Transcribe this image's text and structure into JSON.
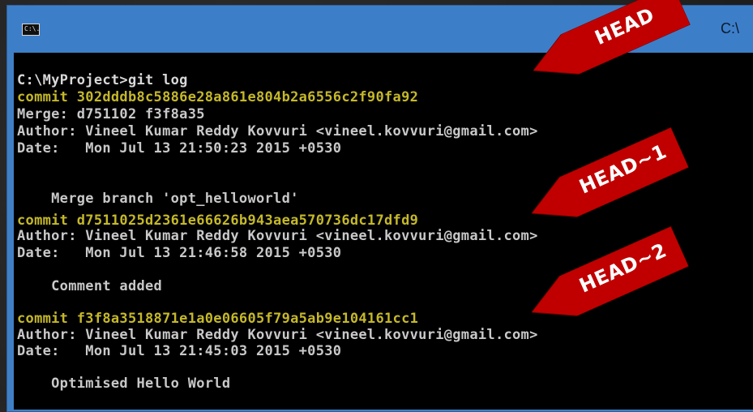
{
  "window": {
    "title": "C:\\",
    "icon": "cmd-icon",
    "icon_text": "C:\\."
  },
  "console": {
    "lines": [
      {
        "text": "C:\\MyProject>git log",
        "kind": "prompt"
      },
      {
        "text": "commit 302dddb8c5886e28a861e804b2a6556c2f90fa92",
        "kind": "commit"
      },
      {
        "text": "Merge: d751102 f3f8a35",
        "kind": "text"
      },
      {
        "text": "Author: Vineel Kumar Reddy Kovvuri <vineel.kovvuri@gmail.com>",
        "kind": "text"
      },
      {
        "text": "Date:   Mon Jul 13 21:50:23 2015 +0530",
        "kind": "text"
      },
      {
        "text": "",
        "kind": "text"
      },
      {
        "text": "    Merge branch 'opt_helloworld'",
        "kind": "text"
      },
      {
        "text": "",
        "kind": "text"
      },
      {
        "text": "commit d7511025d2361e66626b943aea570736dc17dfd9",
        "kind": "commit"
      },
      {
        "text": "Author: Vineel Kumar Reddy Kovvuri <vineel.kovvuri@gmail.com>",
        "kind": "text"
      },
      {
        "text": "Date:   Mon Jul 13 21:46:58 2015 +0530",
        "kind": "text"
      },
      {
        "text": "",
        "kind": "text"
      },
      {
        "text": "    Comment added",
        "kind": "text"
      },
      {
        "text": "",
        "kind": "text"
      },
      {
        "text": "commit f3f8a3518871e1a0e06605f79a5ab9e104161cc1",
        "kind": "commit"
      },
      {
        "text": "Author: Vineel Kumar Reddy Kovvuri <vineel.kovvuri@gmail.com>",
        "kind": "text"
      },
      {
        "text": "Date:   Mon Jul 13 21:45:03 2015 +0530",
        "kind": "text"
      },
      {
        "text": "",
        "kind": "text"
      },
      {
        "text": "    Optimised Hello World",
        "kind": "text"
      }
    ]
  },
  "annotations": [
    {
      "label": "HEAD"
    },
    {
      "label": "HEAD~1"
    },
    {
      "label": "HEAD~2"
    }
  ],
  "colors": {
    "titlebar": "#3d7ec8",
    "console_bg": "#000000",
    "console_text": "#c8c8c8",
    "commit_text": "#c5b82a",
    "arrow_fill": "#c00000"
  }
}
